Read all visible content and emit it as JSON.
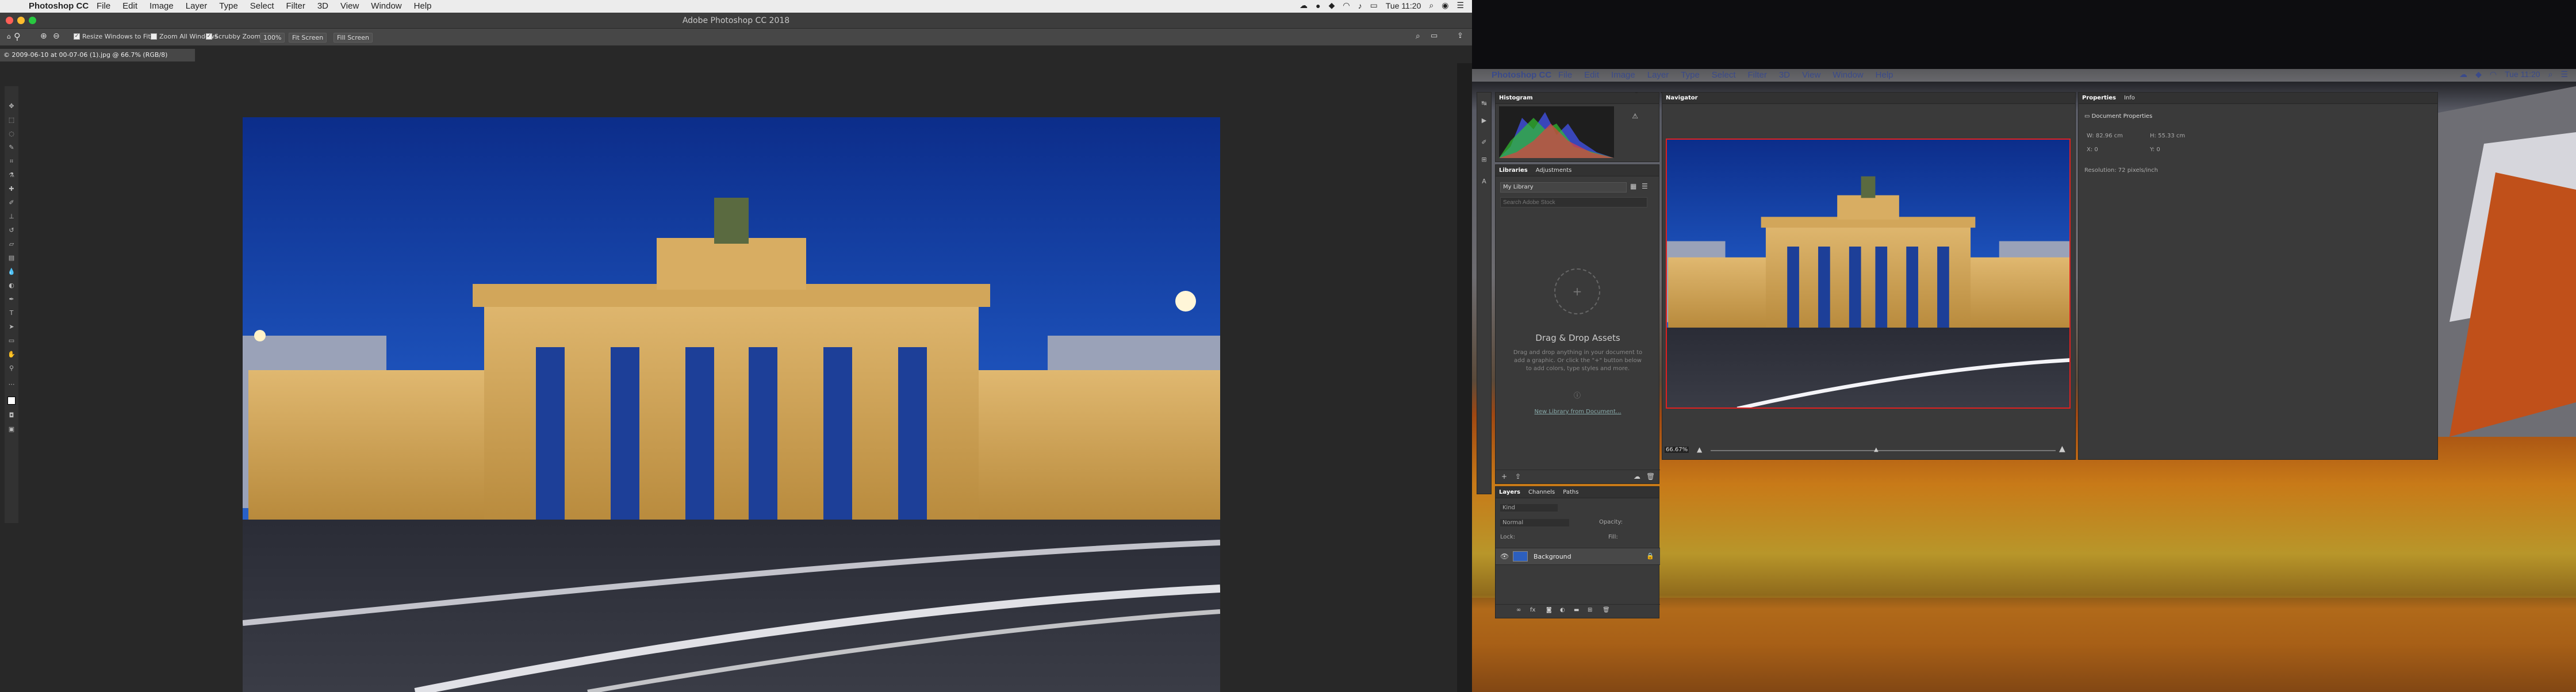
{
  "left": {
    "menubar": {
      "apple": "",
      "app_name": "Photoshop CC",
      "menus": [
        "File",
        "Edit",
        "Image",
        "Layer",
        "Type",
        "Select",
        "Filter",
        "3D",
        "View",
        "Window",
        "Help"
      ],
      "clock": "Tue 11:20"
    },
    "window_title": "Adobe Photoshop CC 2018",
    "options": {
      "resize": "Resize Windows to Fit",
      "zoom_all": "Zoom All Windows",
      "scrubby": "Scrubby Zoom",
      "zoom_value": "100%",
      "fit_screen": "Fit Screen",
      "fill_screen": "Fill Screen"
    },
    "doc_tab": "© 2009-06-10 at 00-07-06 (1).jpg @ 66.7% (RGB/8)"
  },
  "right": {
    "menubar": {
      "apple": "",
      "app_name": "Photoshop CC",
      "menus": [
        "File",
        "Edit",
        "Image",
        "Layer",
        "Type",
        "Select",
        "Filter",
        "3D",
        "View",
        "Window",
        "Help"
      ],
      "clock": "Tue 11:20"
    },
    "histogram": {
      "title": "Histogram"
    },
    "libraries": {
      "tabs": [
        "Libraries",
        "Adjustments"
      ],
      "library_select": "My Library",
      "search_placeholder": "Search Adobe Stock",
      "drag_title": "Drag & Drop Assets",
      "drag_text": "Drag and drop anything in your document to add a graphic. Or click the \"+\" button below to add colors, type styles and more.",
      "link": "New Library from Document..."
    },
    "navigator": {
      "title": "Navigator",
      "zoom": "66.67%"
    },
    "properties": {
      "tabs": [
        "Properties",
        "Info"
      ],
      "section": "Document Properties",
      "w_label": "W:",
      "w_value": "82.96 cm",
      "h_label": "H:",
      "h_value": "55.33 cm",
      "x_label": "X:",
      "x_value": "0",
      "y_label": "Y:",
      "y_value": "0",
      "resolution": "Resolution: 72 pixels/inch"
    },
    "layers": {
      "tabs": [
        "Layers",
        "Channels",
        "Paths"
      ],
      "kind": "Kind",
      "blend": "Normal",
      "opacity_label": "Opacity:",
      "lock_label": "Lock:",
      "fill_label": "Fill:",
      "layer_name": "Background"
    }
  },
  "colors": {
    "accent": "#2d5fbd",
    "menubar": "#ececec",
    "panel": "#3a3a3a"
  }
}
